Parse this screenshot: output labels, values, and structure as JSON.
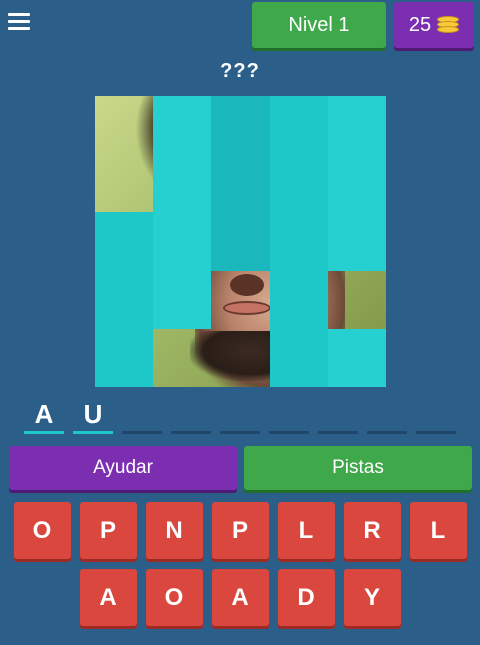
{
  "header": {
    "menu_icon": "hamburger-menu-icon",
    "level_label": "Nivel 1",
    "coins": "25",
    "coin_icon": "coin-stack-icon"
  },
  "question": "???",
  "puzzle": {
    "revealed_tiles": [
      0,
      5,
      17,
      19,
      21,
      22
    ],
    "tile_color": "#1fc8c8"
  },
  "answer": {
    "slots": [
      "A",
      "U",
      "",
      "",
      "",
      "",
      "",
      "",
      ""
    ]
  },
  "actions": {
    "help_label": "Ayudar",
    "hints_label": "Pistas"
  },
  "keyboard": {
    "row1": [
      "O",
      "P",
      "N",
      "P",
      "L",
      "R",
      "L"
    ],
    "row2": [
      "A",
      "O",
      "A",
      "D",
      "Y"
    ]
  },
  "colors": {
    "background": "#2b5f8a",
    "green": "#3ea84a",
    "purple": "#7b2fb0",
    "key_red": "#d9473f"
  }
}
